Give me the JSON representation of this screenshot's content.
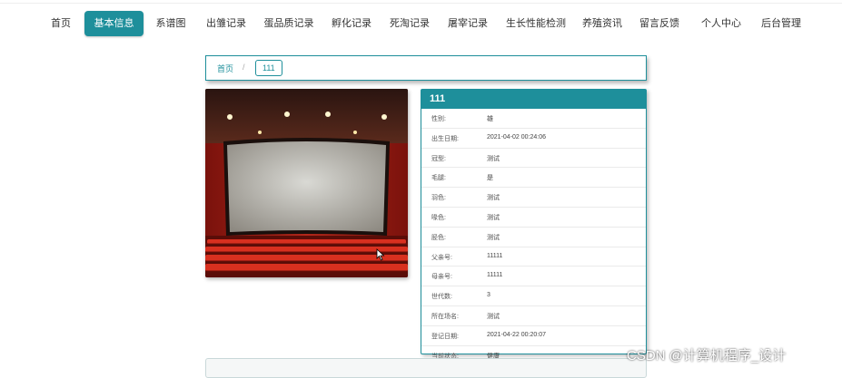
{
  "nav": {
    "items": [
      {
        "label": "首页"
      },
      {
        "label": "基本信息"
      },
      {
        "label": "系谱图"
      },
      {
        "label": "出雏记录"
      },
      {
        "label": "蛋品质记录"
      },
      {
        "label": "孵化记录"
      },
      {
        "label": "死淘记录"
      },
      {
        "label": "屠宰记录"
      },
      {
        "label": "生长性能检测"
      },
      {
        "label": "养殖资讯"
      },
      {
        "label": "留言反馈"
      },
      {
        "label": "个人中心"
      },
      {
        "label": "后台管理"
      }
    ],
    "active_index": 1
  },
  "breadcrumb": {
    "home": "首页",
    "separator": "/",
    "current": "111"
  },
  "detail": {
    "title": "111",
    "fields": [
      {
        "label": "性别:",
        "value": "雄"
      },
      {
        "label": "出生日期:",
        "value": "2021-04-02 00:24:06"
      },
      {
        "label": "冠型:",
        "value": "测试"
      },
      {
        "label": "毛腿:",
        "value": "是"
      },
      {
        "label": "羽色:",
        "value": "测试"
      },
      {
        "label": "喙色:",
        "value": "测试"
      },
      {
        "label": "胫色:",
        "value": "测试"
      },
      {
        "label": "父亲号:",
        "value": "11111"
      },
      {
        "label": "母亲号:",
        "value": "11111"
      },
      {
        "label": "世代数:",
        "value": "3"
      },
      {
        "label": "所在场名:",
        "value": "测试"
      },
      {
        "label": "登记日期:",
        "value": "2021-04-22 00:20:07"
      },
      {
        "label": "当前状态:",
        "value": "健康"
      }
    ]
  },
  "watermark": "CSDN @计算机程序_设计",
  "colors": {
    "accent": "#1e8f9b"
  },
  "icons": [
    "cursor-arrow-icon"
  ]
}
